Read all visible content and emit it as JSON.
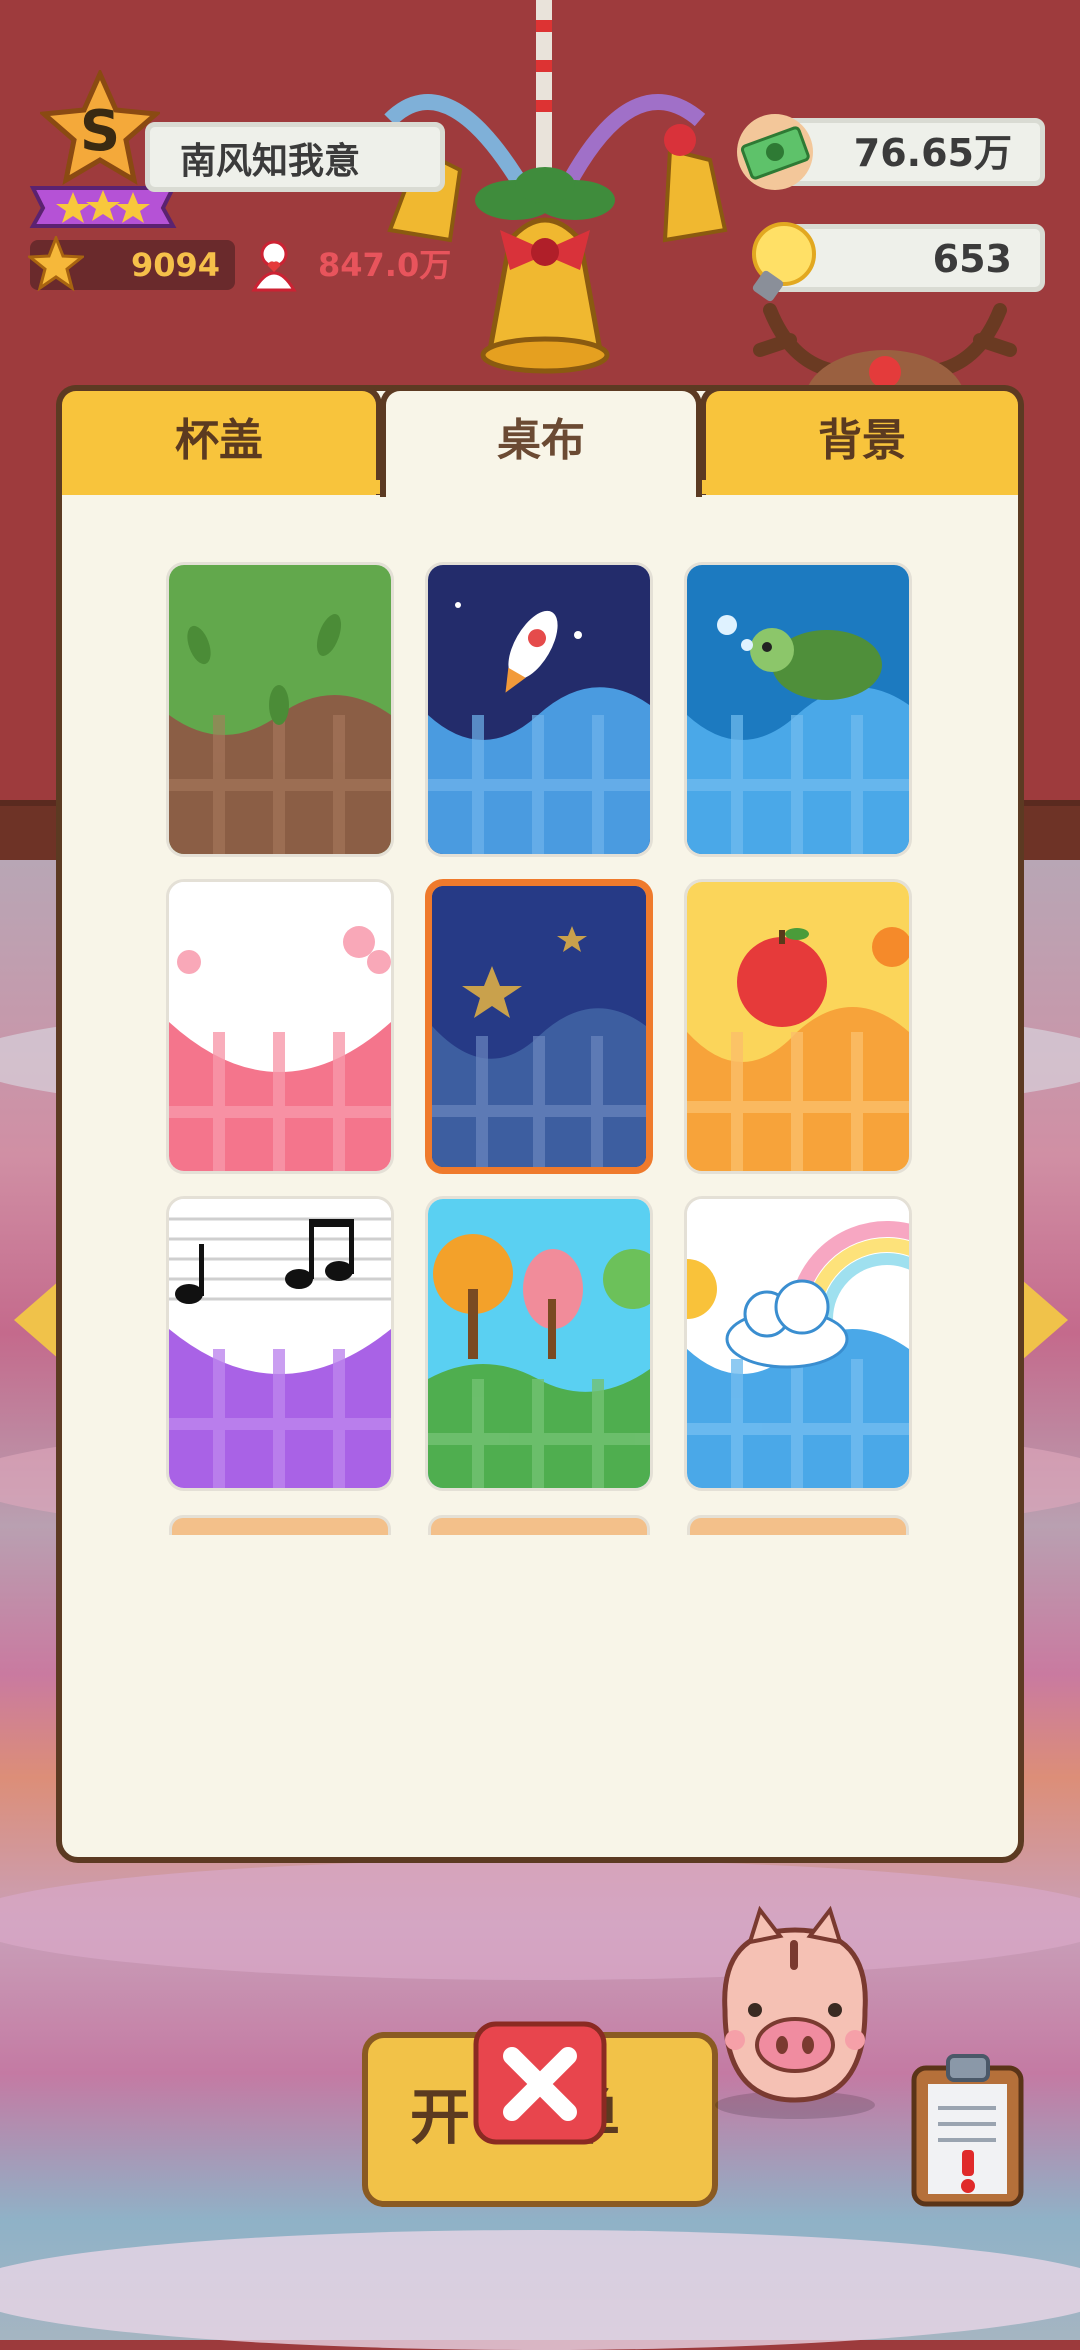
{
  "player": {
    "rank_letter": "S",
    "name": "南风知我意",
    "stars": "9094",
    "fans": "847.0万"
  },
  "currency": {
    "money": "76.65万",
    "ideas": "653"
  },
  "tabs": [
    {
      "label": "杯盖",
      "active": false
    },
    {
      "label": "桌布",
      "active": true
    },
    {
      "label": "背景",
      "active": false
    }
  ],
  "tablecloths": [
    {
      "theme": "green-leaves",
      "selected": false
    },
    {
      "theme": "space-rocket",
      "selected": false
    },
    {
      "theme": "ocean-turtle",
      "selected": false
    },
    {
      "theme": "pink-flowers",
      "selected": false
    },
    {
      "theme": "night-stars",
      "selected": true
    },
    {
      "theme": "fruit-apple",
      "selected": false
    },
    {
      "theme": "music-notes",
      "selected": false
    },
    {
      "theme": "autumn-trees",
      "selected": false
    },
    {
      "theme": "rainbow-cloud",
      "selected": false
    }
  ],
  "bottom": {
    "open_button_label": "开单"
  },
  "colors": {
    "accent": "#f8c43c",
    "selected_border": "#ef7a2c",
    "panel_bg": "#f8f5e8",
    "close_red": "#e8454d"
  }
}
